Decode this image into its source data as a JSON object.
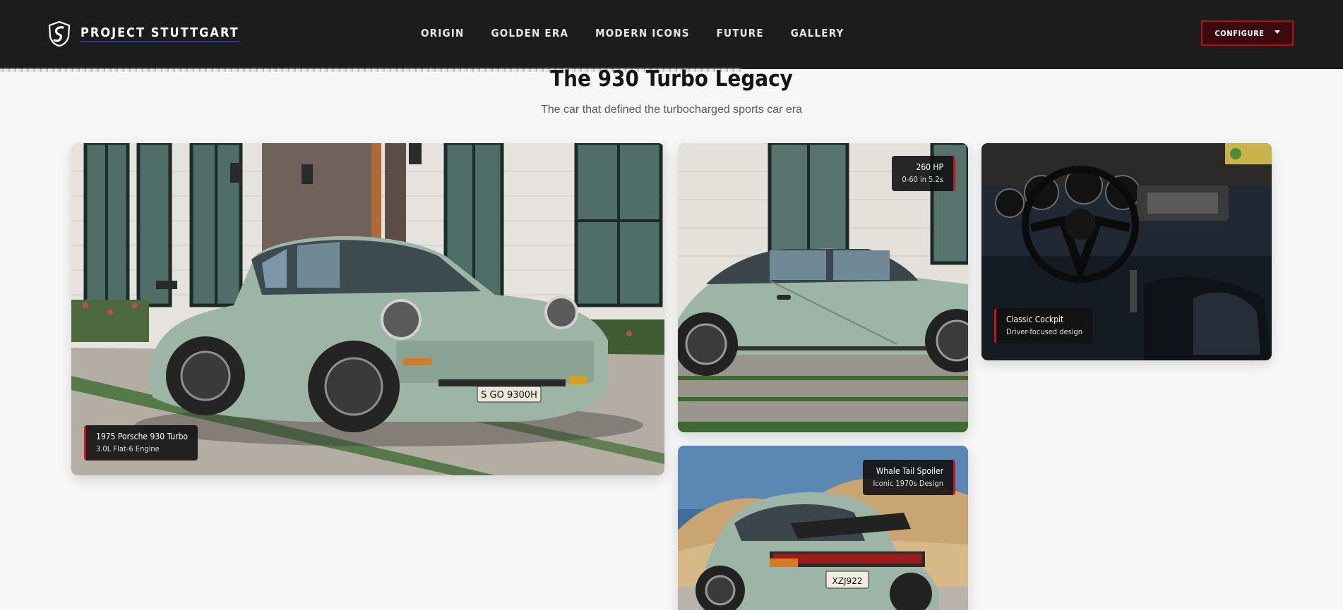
{
  "header": {
    "brand": "PROJECT STUTTGART",
    "nav": [
      "ORIGIN",
      "GOLDEN ERA",
      "MODERN ICONS",
      "FUTURE",
      "GALLERY"
    ],
    "configure_label": "CONFIGURE"
  },
  "section": {
    "title": "The 930 Turbo Legacy",
    "subtitle": "The car that defined the turbocharged sports car era"
  },
  "gallery": {
    "main": {
      "title": "1975 Porsche 930 Turbo",
      "subtitle": "3.0L Flat-6 Engine",
      "plate": "S GO 9300H"
    },
    "side": {
      "title": "260 HP",
      "subtitle": "0-60 in 5.2s"
    },
    "cockpit": {
      "title": "Classic Cockpit",
      "subtitle": "Driver-focused design"
    },
    "rear": {
      "title": "Whale Tail Spoiler",
      "subtitle": "Iconic 1970s Design",
      "plate": "XZJ922"
    }
  },
  "colors": {
    "accent": "#c8141c",
    "nav_bg": "#1c1c1c",
    "car": "#9db5a6"
  }
}
